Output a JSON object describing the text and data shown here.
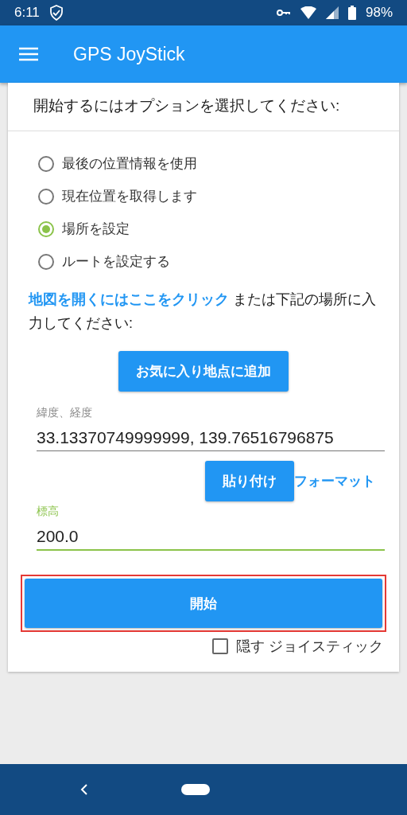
{
  "status_bar": {
    "time": "6:11",
    "battery": "98%"
  },
  "app_bar": {
    "title": "GPS JoyStick"
  },
  "heading": "開始するにはオプションを選択してください:",
  "options": [
    {
      "label": "最後の位置情報を使用",
      "selected": false
    },
    {
      "label": "現在位置を取得します",
      "selected": false
    },
    {
      "label": "場所を設定",
      "selected": true
    },
    {
      "label": "ルートを設定する",
      "selected": false
    }
  ],
  "instruction": {
    "link": "地図を開くにはここをクリック",
    "text": " または下記の場所に入力してください:"
  },
  "favorite_button": "お気に入り地点に追加",
  "coordinates": {
    "label": "緯度、経度",
    "value": "33.13370749999999, 139.76516796875",
    "focused": false
  },
  "paste_button": "貼り付け",
  "format_link": "フォーマット",
  "altitude": {
    "label": "標高",
    "value": "200.0",
    "focused": true
  },
  "start_button": {
    "label": "開始",
    "highlighted": true
  },
  "hide_joystick": {
    "label": "隠す ジョイスティック",
    "checked": false
  }
}
